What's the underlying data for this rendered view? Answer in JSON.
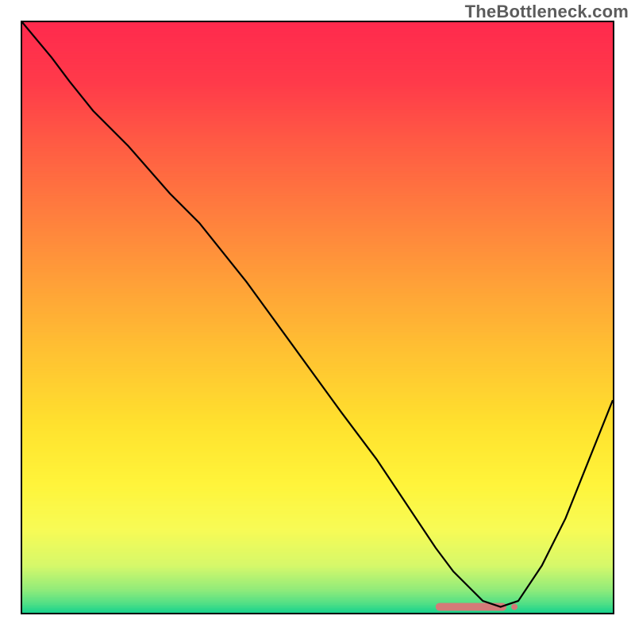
{
  "watermark": "TheBottleneck.com",
  "chart_data": {
    "type": "line",
    "title": "",
    "xlabel": "",
    "ylabel": "",
    "xlim": [
      0,
      100
    ],
    "ylim": [
      0,
      100
    ],
    "series": [
      {
        "name": "bottleneck-curve",
        "x": [
          0,
          5,
          8,
          12,
          18,
          25,
          30,
          38,
          46,
          54,
          60,
          66,
          70,
          73,
          76,
          78,
          81,
          84,
          88,
          92,
          96,
          100
        ],
        "y": [
          100,
          94,
          90,
          85,
          79,
          71,
          66,
          56,
          45,
          34,
          26,
          17,
          11,
          7,
          4,
          2,
          1,
          2,
          8,
          16,
          26,
          36
        ]
      }
    ],
    "valley_marker": {
      "x_start": 70,
      "x_end": 82,
      "y": 1
    },
    "background_gradient": {
      "stops": [
        {
          "pos": 0.0,
          "color": "#ff2a4d"
        },
        {
          "pos": 0.1,
          "color": "#ff3a4a"
        },
        {
          "pos": 0.2,
          "color": "#ff5a44"
        },
        {
          "pos": 0.32,
          "color": "#ff7d3e"
        },
        {
          "pos": 0.44,
          "color": "#ffa038"
        },
        {
          "pos": 0.56,
          "color": "#ffc232"
        },
        {
          "pos": 0.68,
          "color": "#ffe12e"
        },
        {
          "pos": 0.78,
          "color": "#fff43a"
        },
        {
          "pos": 0.86,
          "color": "#f7fb56"
        },
        {
          "pos": 0.92,
          "color": "#d6f86a"
        },
        {
          "pos": 0.96,
          "color": "#93ec7a"
        },
        {
          "pos": 0.985,
          "color": "#4fdf86"
        },
        {
          "pos": 1.0,
          "color": "#17d28d"
        }
      ]
    },
    "colors": {
      "curve": "#000000",
      "marker": "#d47a78",
      "frame": "#000000"
    }
  }
}
